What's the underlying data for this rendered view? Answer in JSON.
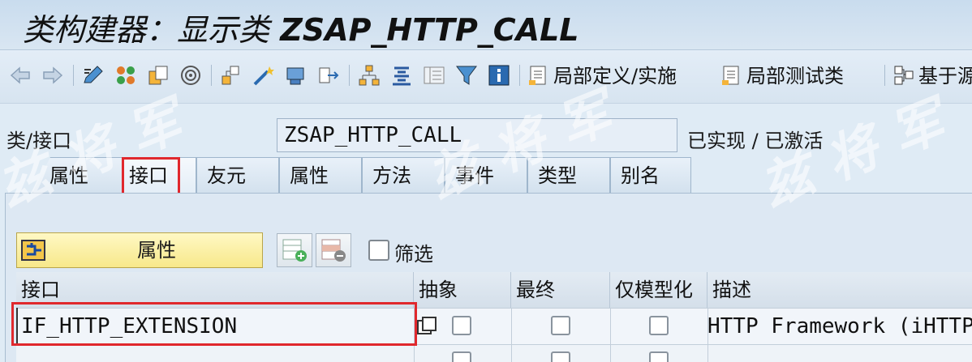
{
  "window": {
    "title_prefix": "类构建器：显示类",
    "title_class": "ZSAP_HTTP_CALL"
  },
  "toolbar": {
    "icons": [
      "back-arrow-icon",
      "forward-arrow-icon",
      "edit-toggle-icon",
      "object-list-icon",
      "other-object-icon",
      "where-used-icon",
      "hierarchy-icon",
      "magic-wand-icon",
      "display-object-icon",
      "navigate-icon",
      "tree-icon",
      "align-icon",
      "layout-icon",
      "filter-icon",
      "info-icon"
    ],
    "local_definitions_label": "局部定义/实施",
    "local_test_classes_label": "局部测试类",
    "based_on_source_label": "基于源"
  },
  "header": {
    "class_label": "类/接口",
    "class_value": "ZSAP_HTTP_CALL",
    "status": "已实现 / 已激活"
  },
  "tabs": [
    {
      "label": "属性"
    },
    {
      "label": "接口"
    },
    {
      "label": "友元"
    },
    {
      "label": "属性"
    },
    {
      "label": "方法"
    },
    {
      "label": "事件"
    },
    {
      "label": "类型"
    },
    {
      "label": "别名"
    }
  ],
  "panel": {
    "attributes_button": "属性",
    "filter_label": "筛选"
  },
  "table": {
    "headers": [
      "接口",
      "抽象",
      "最终",
      "仅模型化",
      "描述"
    ],
    "rows": [
      {
        "interface": "IF_HTTP_EXTENSION",
        "abstract": false,
        "final": false,
        "modeled_only": false,
        "description": "HTTP Framework (iHTTP"
      }
    ]
  },
  "watermark": "兹 将 军",
  "colors": {
    "highlight": "#e0282d",
    "button_yellow": "#f7e88a"
  }
}
